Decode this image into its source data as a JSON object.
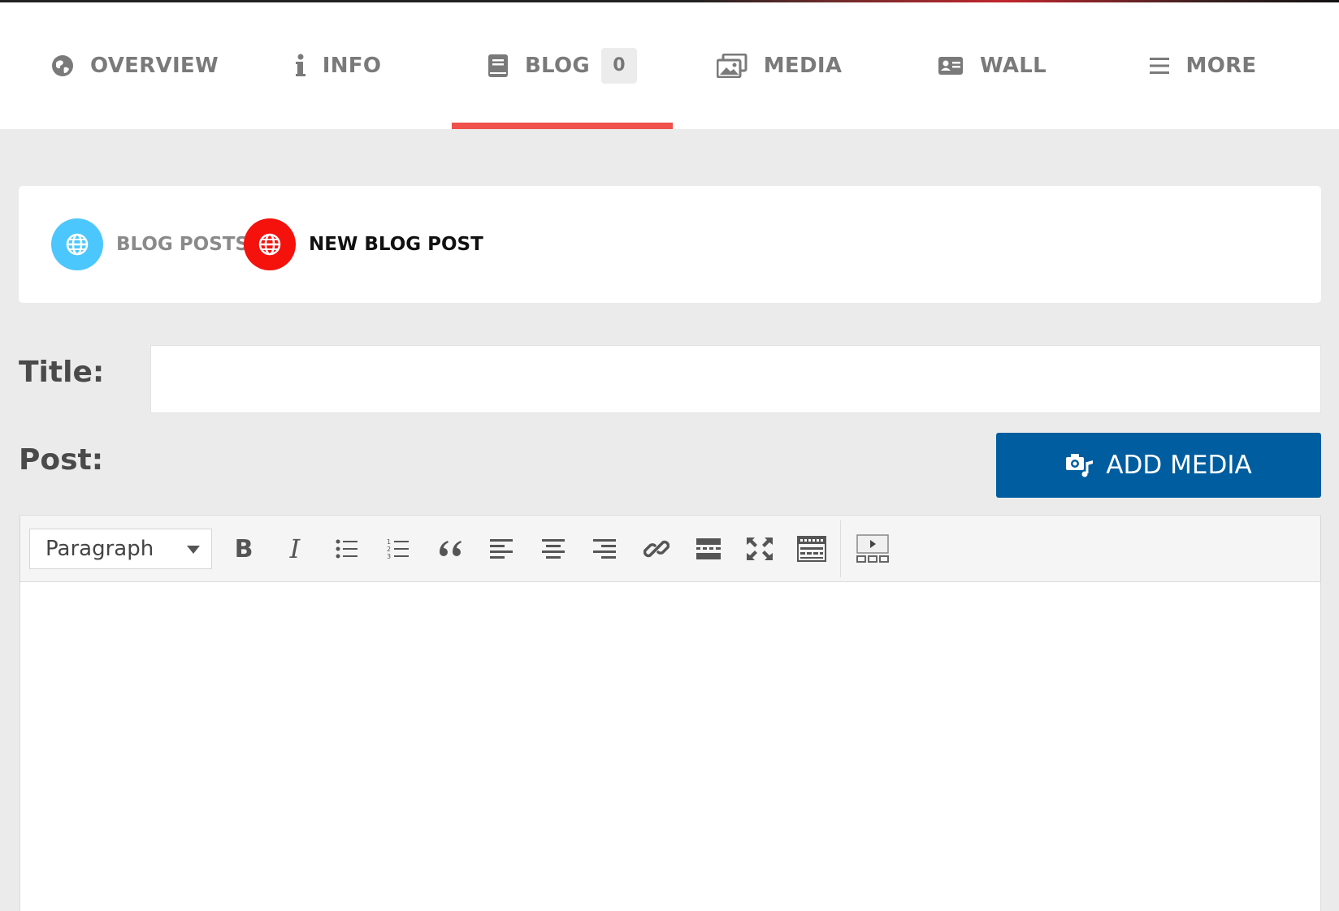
{
  "nav": {
    "tabs": [
      {
        "label": "OVERVIEW",
        "icon": "globe-icon"
      },
      {
        "label": "INFO",
        "icon": "info-icon"
      },
      {
        "label": "BLOG",
        "icon": "book-icon",
        "count": "0",
        "active": true
      },
      {
        "label": "MEDIA",
        "icon": "images-icon"
      },
      {
        "label": "WALL",
        "icon": "id-card-icon"
      },
      {
        "label": "MORE",
        "icon": "menu-icon"
      }
    ],
    "active_color": "#f0514c"
  },
  "blog_menu": {
    "blog_posts_label": "BLOG POSTS",
    "new_blog_post_label": "NEW BLOG POST",
    "blog_posts_color": "#4cc7fd",
    "new_blog_post_color": "#f5110c"
  },
  "form": {
    "title_label": "Title:",
    "title_value": "",
    "post_label": "Post:",
    "add_media_label": "ADD MEDIA",
    "add_media_color": "#005d9f"
  },
  "editor": {
    "format_value": "Paragraph",
    "toolbar_icons": [
      "bold-icon",
      "italic-icon",
      "bullet-list-icon",
      "numbered-list-icon",
      "blockquote-icon",
      "align-left-icon",
      "align-center-icon",
      "align-right-icon",
      "link-icon",
      "read-more-icon",
      "fullscreen-icon",
      "toolbar-toggle-icon",
      "insert-media-icon"
    ],
    "bold_glyph": "B",
    "italic_glyph": "I"
  }
}
